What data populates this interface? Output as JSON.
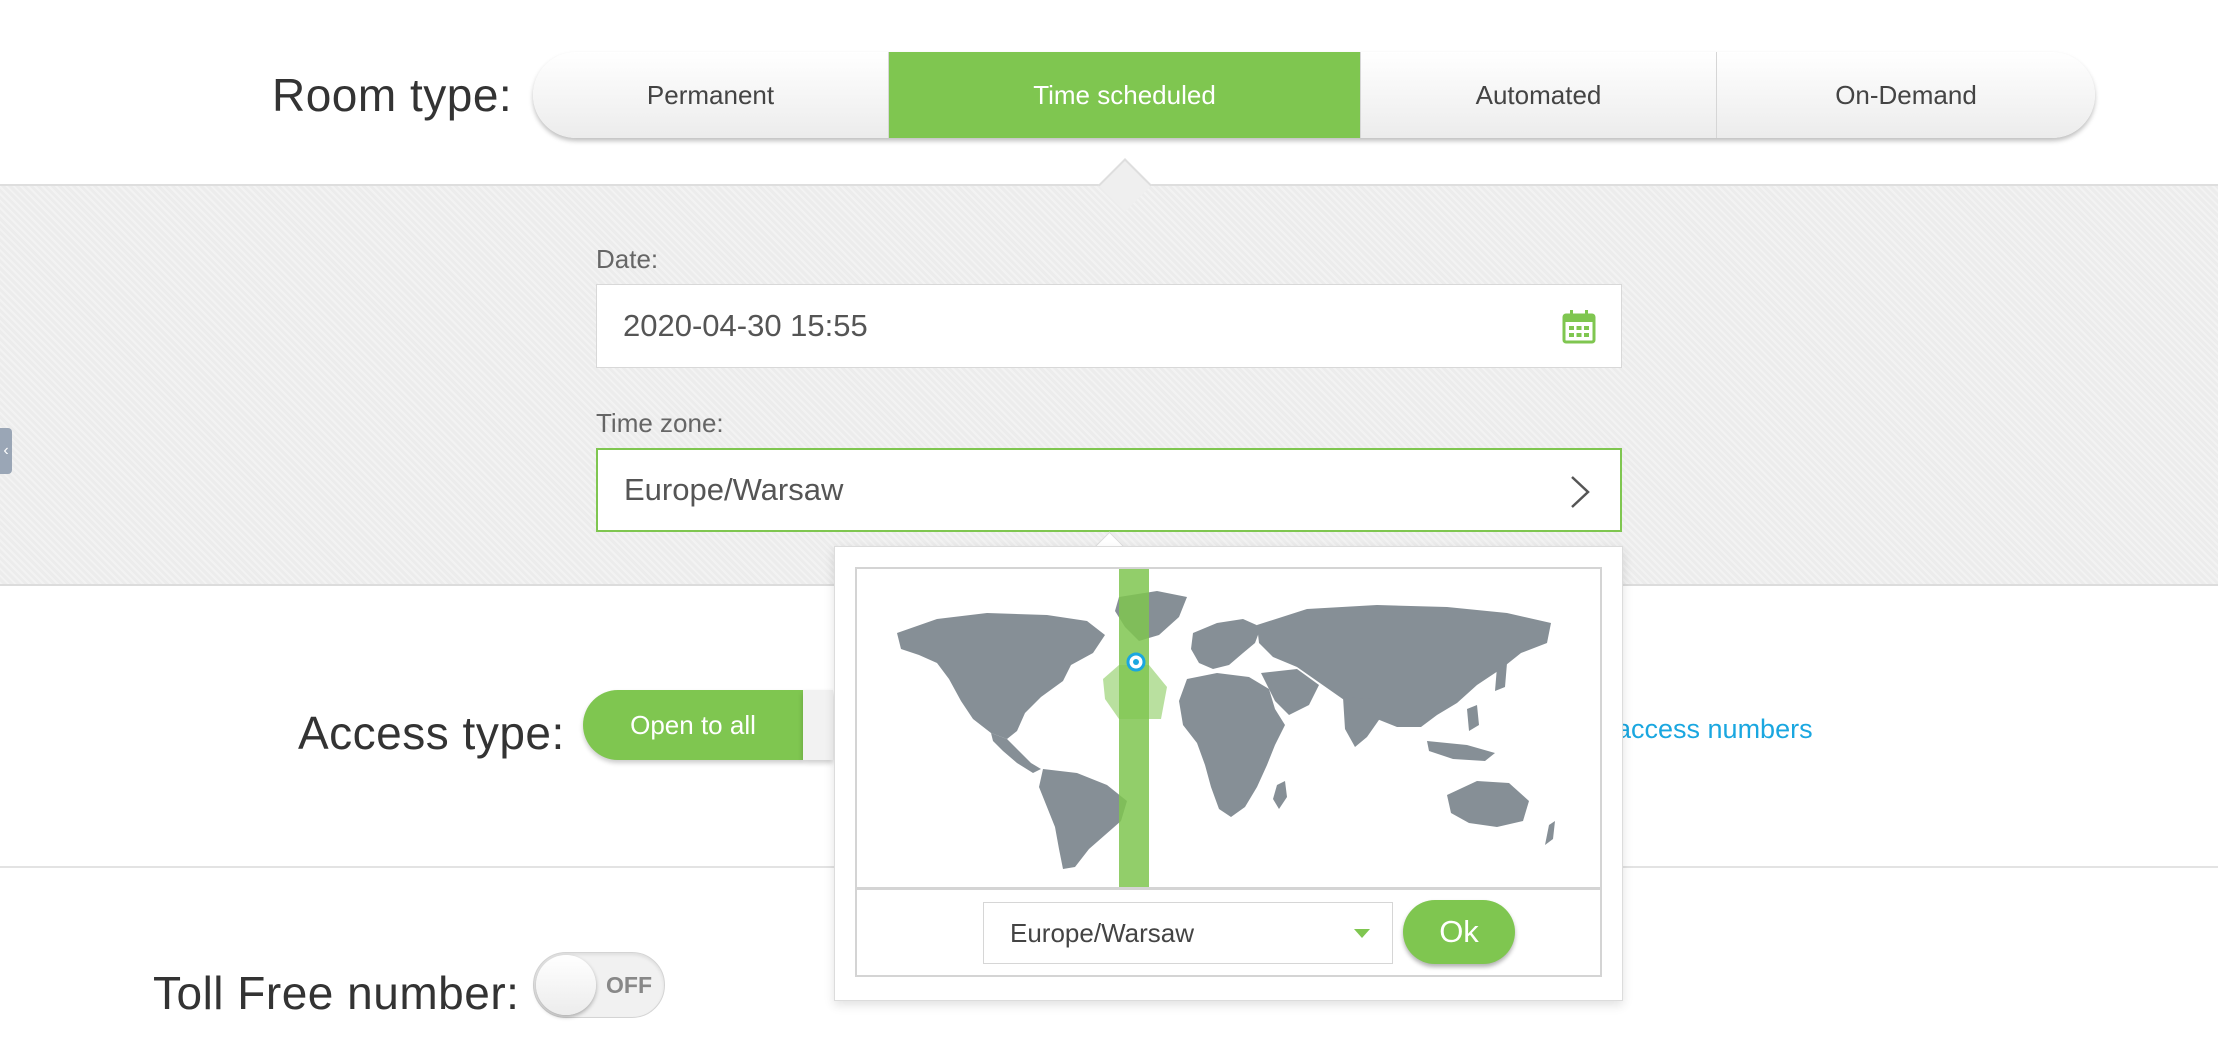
{
  "room_type": {
    "label": "Room type:",
    "options": [
      "Permanent",
      "Time scheduled",
      "Automated",
      "On-Demand"
    ],
    "selected": "Time scheduled"
  },
  "schedule": {
    "date_label": "Date:",
    "date_value": "2020-04-30 15:55",
    "timezone_label": "Time zone:",
    "timezone_value": "Europe/Warsaw"
  },
  "access": {
    "label": "Access type:",
    "open_to_all": "Open to all",
    "access_numbers_link": "access numbers"
  },
  "toll_free": {
    "label": "Toll Free number:",
    "state": "OFF"
  },
  "timezone_popup": {
    "selected_zone": "Europe/Warsaw",
    "ok_label": "Ok"
  },
  "colors": {
    "accent_green": "#7fc650",
    "link_blue": "#1aa7e0",
    "map_land": "#868f96"
  },
  "icons": {
    "calendar": "calendar-icon",
    "chevron": "chevron-right-icon",
    "collapse": "chevron-left-icon",
    "location": "location-pin-icon"
  }
}
